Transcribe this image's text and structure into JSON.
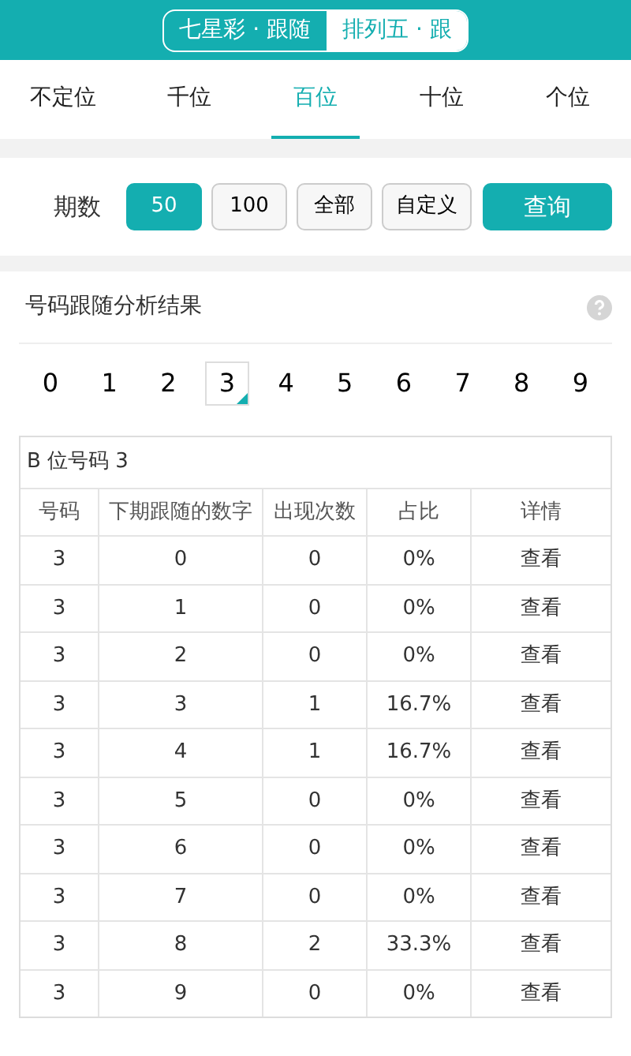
{
  "header": {
    "segments": [
      {
        "label": "七星彩 · 跟随",
        "selected": false
      },
      {
        "label": "排列五 · 跟",
        "selected": true
      }
    ]
  },
  "position_tabs": [
    {
      "label": "不定位",
      "selected": false
    },
    {
      "label": "千位",
      "selected": false
    },
    {
      "label": "百位",
      "selected": true
    },
    {
      "label": "十位",
      "selected": false
    },
    {
      "label": "个位",
      "selected": false
    }
  ],
  "period": {
    "label": "期数",
    "options": [
      {
        "label": "50",
        "selected": true
      },
      {
        "label": "100",
        "selected": false
      },
      {
        "label": "全部",
        "selected": false
      },
      {
        "label": "自定义",
        "selected": false
      }
    ],
    "query_button": "查询"
  },
  "results": {
    "title": "号码跟随分析结果",
    "digits": [
      {
        "label": "0",
        "selected": false
      },
      {
        "label": "1",
        "selected": false
      },
      {
        "label": "2",
        "selected": false
      },
      {
        "label": "3",
        "selected": true
      },
      {
        "label": "4",
        "selected": false
      },
      {
        "label": "5",
        "selected": false
      },
      {
        "label": "6",
        "selected": false
      },
      {
        "label": "7",
        "selected": false
      },
      {
        "label": "8",
        "selected": false
      },
      {
        "label": "9",
        "selected": false
      }
    ],
    "table": {
      "caption": "B 位号码 3",
      "columns": [
        "号码",
        "下期跟随的数字",
        "出现次数",
        "占比",
        "详情"
      ],
      "rows": [
        [
          "3",
          "0",
          "0",
          "0%",
          "查看"
        ],
        [
          "3",
          "1",
          "0",
          "0%",
          "查看"
        ],
        [
          "3",
          "2",
          "0",
          "0%",
          "查看"
        ],
        [
          "3",
          "3",
          "1",
          "16.7%",
          "查看"
        ],
        [
          "3",
          "4",
          "1",
          "16.7%",
          "查看"
        ],
        [
          "3",
          "5",
          "0",
          "0%",
          "查看"
        ],
        [
          "3",
          "6",
          "0",
          "0%",
          "查看"
        ],
        [
          "3",
          "7",
          "0",
          "0%",
          "查看"
        ],
        [
          "3",
          "8",
          "2",
          "33.3%",
          "查看"
        ],
        [
          "3",
          "9",
          "0",
          "0%",
          "查看"
        ]
      ]
    }
  }
}
